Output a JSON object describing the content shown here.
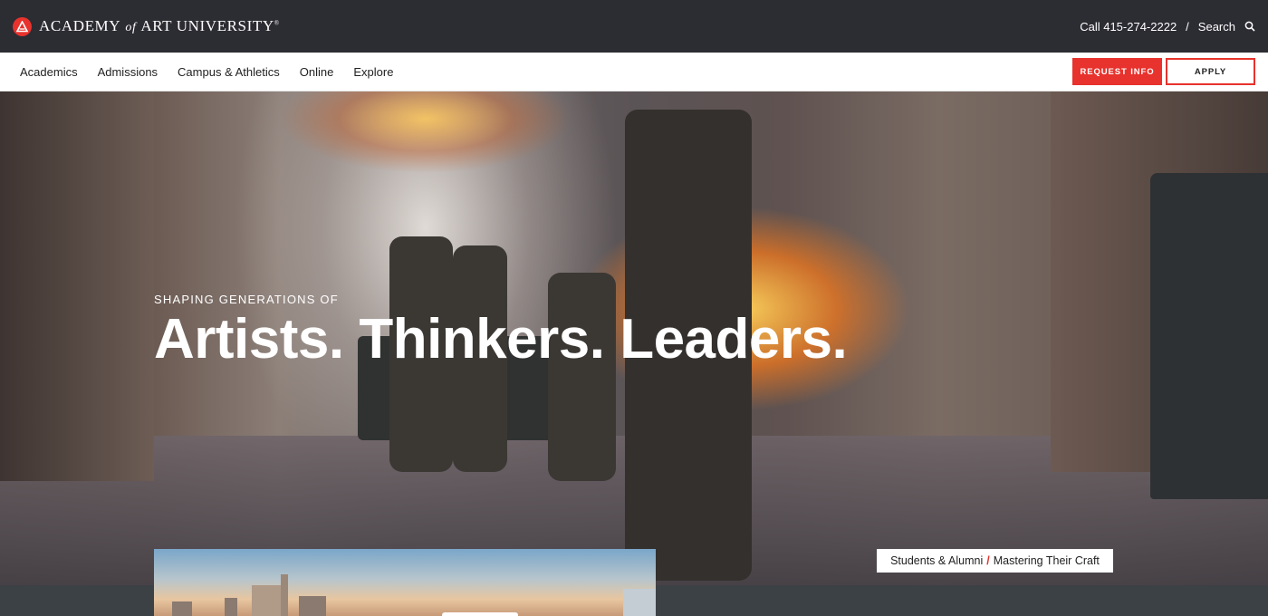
{
  "header": {
    "brand_left": "ACADEMY",
    "brand_of": "of",
    "brand_right": "ART UNIVERSITY",
    "brand_mark": "®",
    "phone": "Call 415-274-2222",
    "separator": "/",
    "search_label": "Search"
  },
  "nav": {
    "items": [
      {
        "label": "Academics"
      },
      {
        "label": "Admissions"
      },
      {
        "label": "Campus & Athletics"
      },
      {
        "label": "Online"
      },
      {
        "label": "Explore"
      }
    ],
    "request_info_label": "REQUEST INFO",
    "apply_label": "APPLY"
  },
  "hero": {
    "tagline": "SHAPING GENERATIONS OF",
    "headline": "Artists. Thinkers. Leaders.",
    "caption_left": "Students & Alumni",
    "caption_separator": "/",
    "caption_right": "Mastering Their Craft"
  },
  "colors": {
    "brand_red": "#e8322d",
    "topbar": "#2c2c33"
  }
}
